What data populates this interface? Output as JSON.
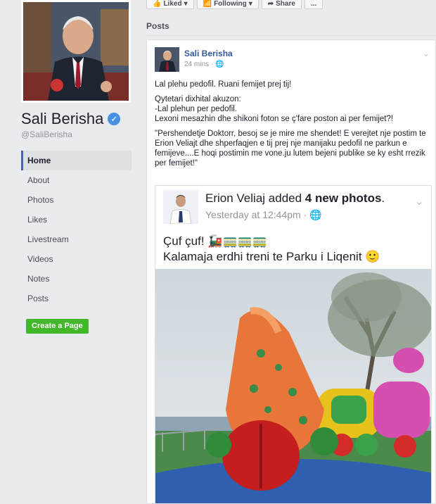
{
  "profile": {
    "name": "Sali Berisha",
    "handle": "@SaliBerisha",
    "verified_glyph": "✓"
  },
  "nav": {
    "items": [
      {
        "label": "Home",
        "active": true
      },
      {
        "label": "About"
      },
      {
        "label": "Photos"
      },
      {
        "label": "Likes"
      },
      {
        "label": "Livestream"
      },
      {
        "label": "Videos"
      },
      {
        "label": "Notes"
      },
      {
        "label": "Posts"
      }
    ],
    "create_page": "Create a Page"
  },
  "topbar": {
    "liked": "Liked",
    "following": "Following",
    "share": "Share",
    "more": "..."
  },
  "section_title": "Posts",
  "post": {
    "author": "Sali Berisha",
    "time": "24 mins",
    "paragraphs": [
      "Lal plehu pedofil. Ruani femijet prej tij!",
      "Qytetari dixhital akuzon:",
      "-Lal plehun per pedofil.",
      "Lexoni mesazhin dhe shikoni foton se ç'fare poston ai per femijet?!",
      "\"Pershendetje Doktorr, besoj se je mire me shendet! E verejtet nje postim te Erion Veliajt dhe shperfaqjen e tij prej nje manijaku pedofil ne parkun e femijeve....E hoqi postimin me vone.ju lutem bejeni publike se ky esht rrezik per femijet!\""
    ]
  },
  "shared": {
    "name": "Erion Veliaj",
    "action_pre": " added ",
    "action_bold": "4 new photos",
    "action_post": ".",
    "time": "Yesterday at 12:44pm",
    "line1": "Çuf çuf! ",
    "line1_emoji": "🚂🚃🚃🚃",
    "line2": "Kalamaja erdhi treni te Parku i Liqenit ",
    "line2_emoji": "🙂"
  },
  "icons": {
    "globe": "globe-icon",
    "chevron": "chevron-down-icon",
    "verified": "verified-badge-icon"
  },
  "colors": {
    "link": "#365899",
    "create_page": "#42b72a",
    "verified": "#4a90e2"
  }
}
